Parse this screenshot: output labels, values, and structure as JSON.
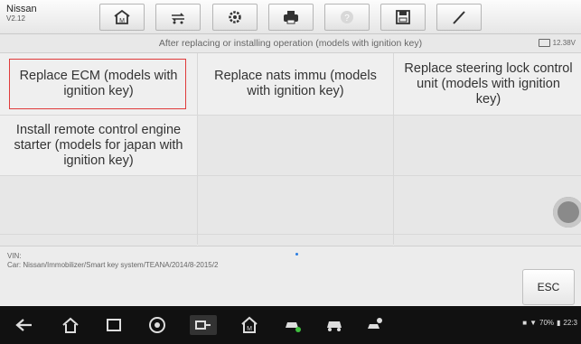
{
  "app": {
    "brand": "Nissan",
    "version": "V2.12"
  },
  "toolbar": {
    "buttons": [
      {
        "name": "home-icon"
      },
      {
        "name": "vehicle-swap-icon"
      },
      {
        "name": "settings-gear-icon"
      },
      {
        "name": "print-icon"
      },
      {
        "name": "help-icon"
      },
      {
        "name": "save-icon"
      },
      {
        "name": "edit-pen-icon"
      }
    ]
  },
  "subheader": {
    "title": "After replacing or installing operation (models with ignition key)",
    "voltage": "12.38V"
  },
  "functions": [
    {
      "label": "Replace ECM (models with ignition key)",
      "selected": true
    },
    {
      "label": "Replace nats immu (models with ignition key)"
    },
    {
      "label": "Replace steering lock control unit (models with ignition key)"
    },
    {
      "label": "Install remote control engine starter (models for japan with ignition key)"
    },
    {
      "label": ""
    },
    {
      "label": ""
    },
    {
      "label": ""
    },
    {
      "label": ""
    },
    {
      "label": ""
    },
    {
      "label": ""
    },
    {
      "label": ""
    },
    {
      "label": ""
    }
  ],
  "footer": {
    "vin_label": "VIN:",
    "car_path": "Car: Nissan/Immobilizer/Smart key system/TEANA/2014/8-2015/2",
    "esc_label": "ESC"
  },
  "system_bar": {
    "battery": "70%",
    "time": "22:3"
  },
  "colors": {
    "selection": "#e03a3a",
    "accent": "#2a7de1"
  }
}
